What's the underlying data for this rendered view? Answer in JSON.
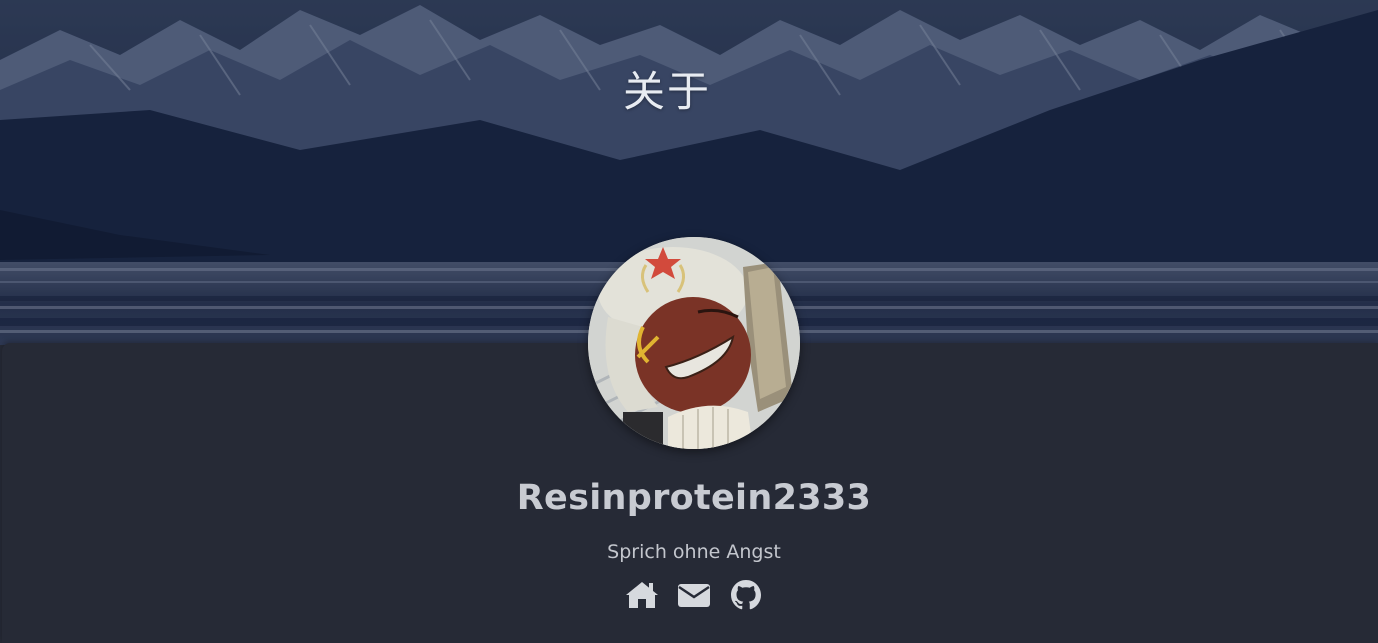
{
  "page": {
    "title": "关于"
  },
  "profile": {
    "username": "Resinprotein2333",
    "motto": "Sprich ohne Angst",
    "avatar_icon": "avatar-image"
  },
  "socials": [
    {
      "icon": "home-icon",
      "color": "#d6d9de"
    },
    {
      "icon": "envelope-icon",
      "color": "#d6d9de"
    },
    {
      "icon": "github-icon",
      "color": "#d6d9de"
    }
  ],
  "colors": {
    "background": "#262a36",
    "banner_overlay": "#14203a",
    "text_primary": "#c8cbd2"
  }
}
